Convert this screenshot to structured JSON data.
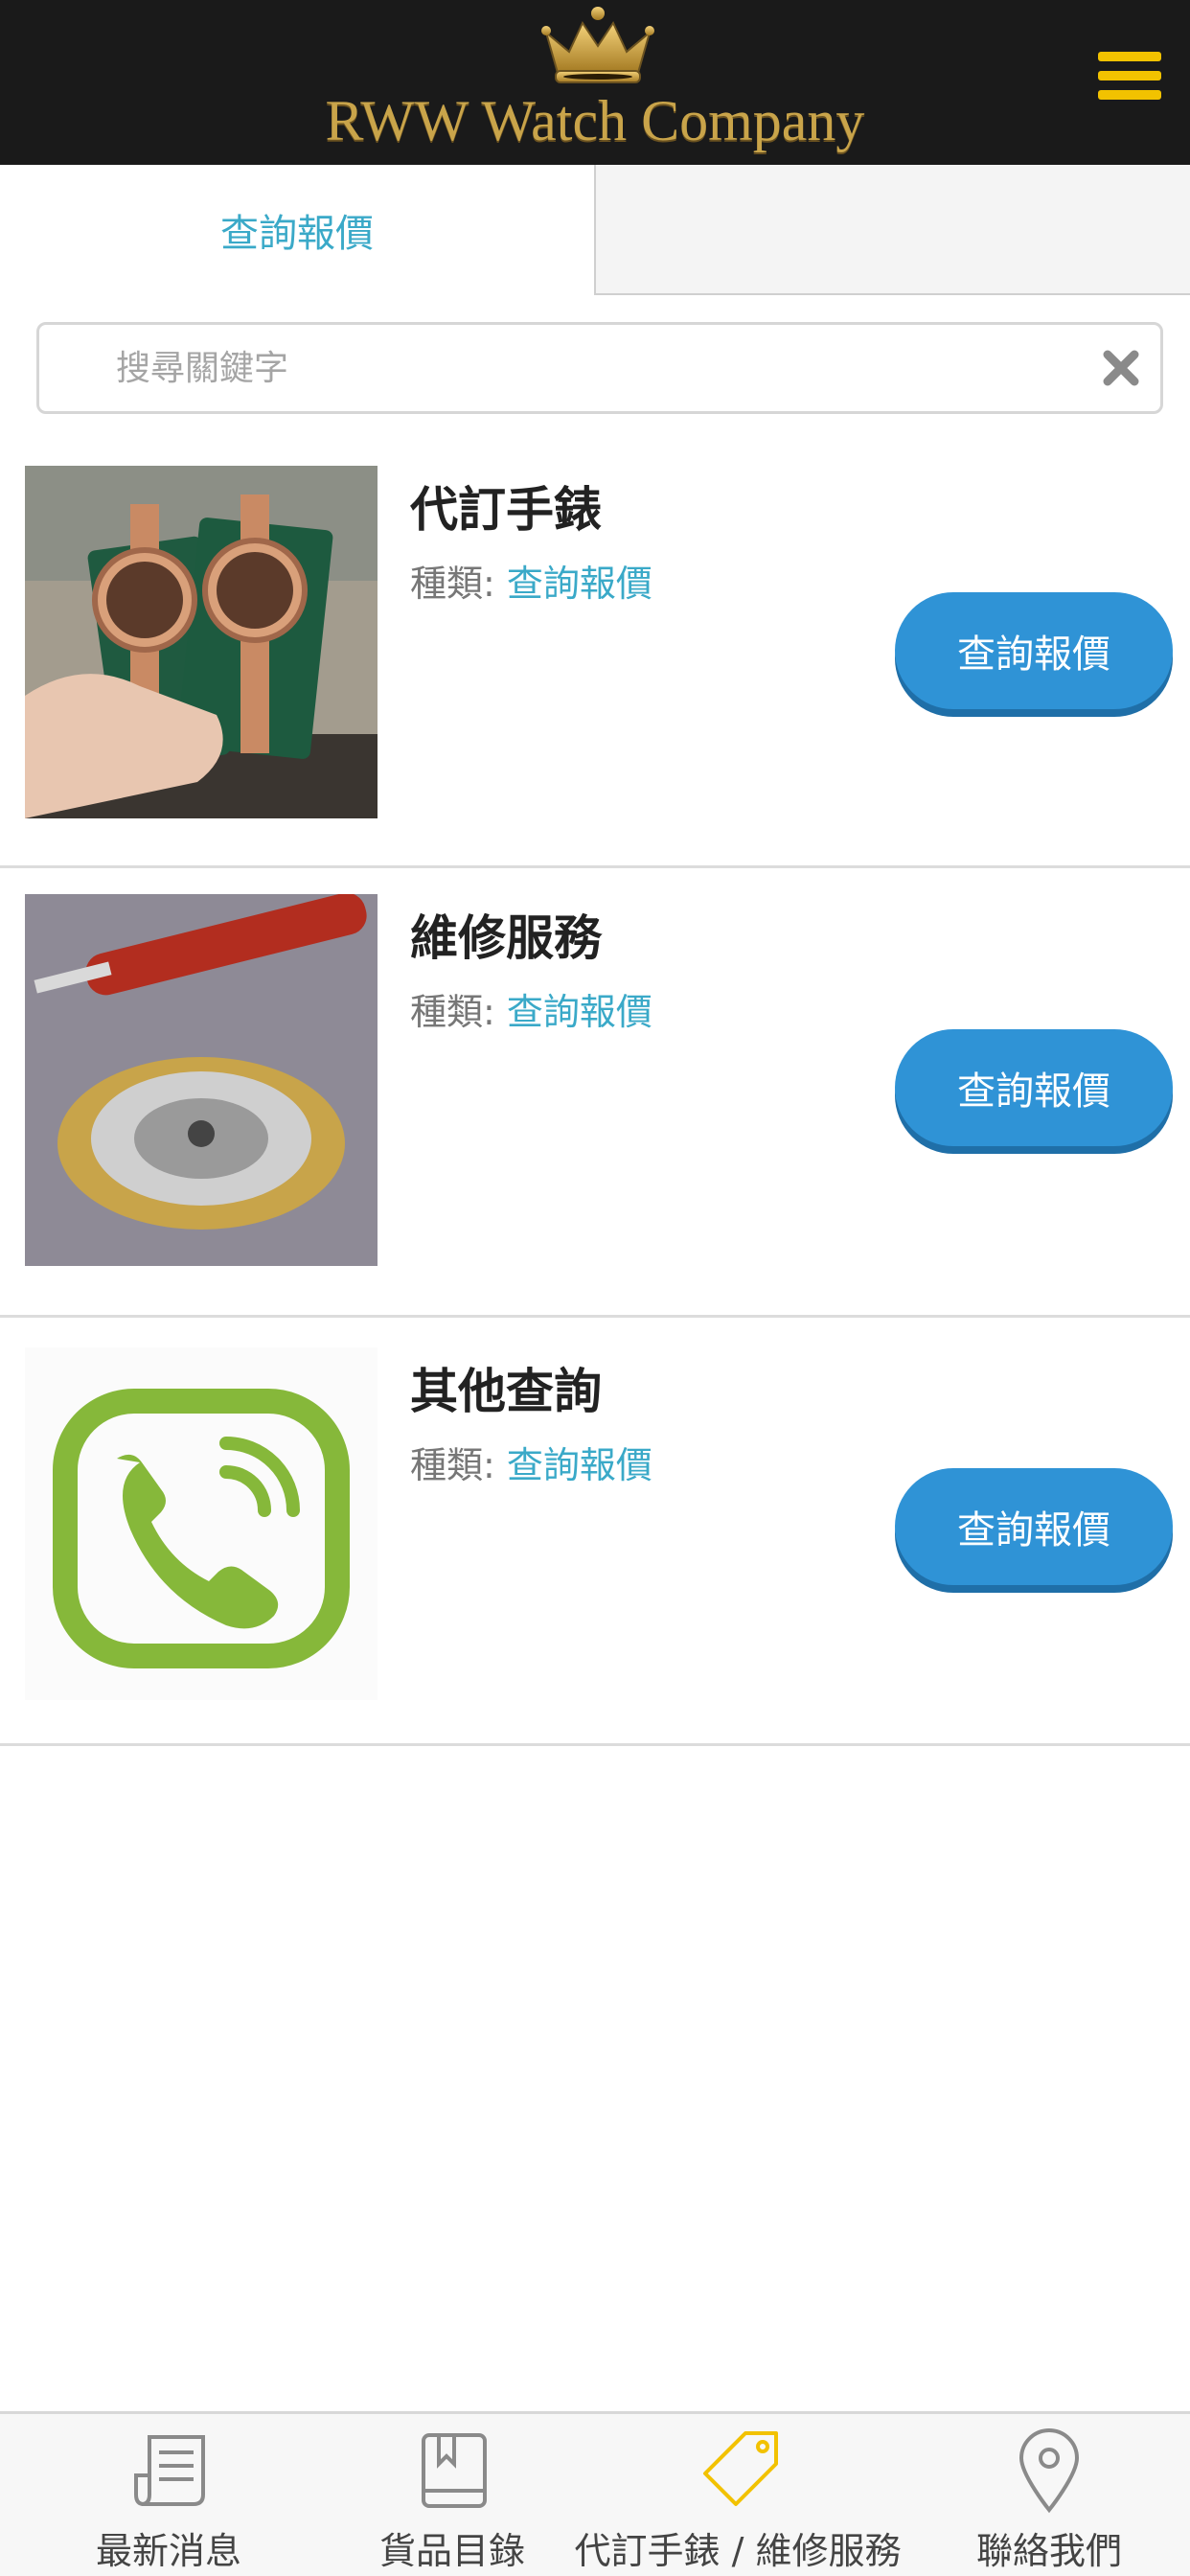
{
  "header": {
    "brand": "RWW Watch Company",
    "logo_icon": "crown-icon",
    "menu_icon": "hamburger-menu-icon",
    "brand_color": "#c9a44a",
    "menu_color": "#f2c200"
  },
  "tabs": [
    {
      "label": "查詢報價",
      "active": true
    },
    {
      "label": "",
      "active": false
    }
  ],
  "search": {
    "placeholder": "搜尋關鍵字",
    "value": "",
    "clear_icon": "close-x-icon"
  },
  "items": [
    {
      "title": "代訂手錶",
      "category_label": "種類:",
      "category_value": "查詢報價",
      "button": "查詢報價",
      "image": "two-rose-gold-watches-photo"
    },
    {
      "title": "維修服務",
      "category_label": "種類:",
      "category_value": "查詢報價",
      "button": "查詢報價",
      "image": "watch-movement-repair-photo"
    },
    {
      "title": "其他查詢",
      "category_label": "種類:",
      "category_value": "查詢報價",
      "button": "查詢報價",
      "image": "green-phone-icon-image"
    }
  ],
  "bottom_nav": [
    {
      "label": "最新消息",
      "icon": "newspaper-icon",
      "active": false
    },
    {
      "label": "貨品目錄",
      "icon": "book-icon",
      "active": false
    },
    {
      "label": "代訂手錶 / 維修服務",
      "icon": "price-tag-icon",
      "active": true
    },
    {
      "label": "聯絡我們",
      "icon": "map-pin-icon",
      "active": false
    }
  ],
  "colors": {
    "accent": "#3aa9c8",
    "button": "#2f93d6",
    "active_nav_icon": "#f2c200"
  }
}
